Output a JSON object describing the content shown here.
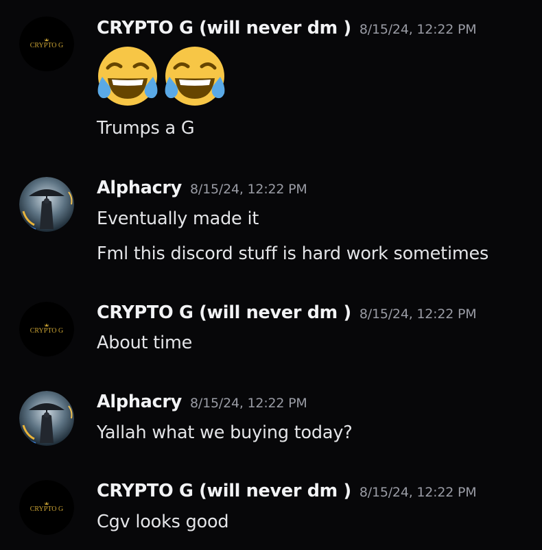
{
  "messages": [
    {
      "author": "CRYPTO G (will never dm )",
      "timestamp": "8/15/24, 12:22 PM",
      "avatar": "crypto-g-logo",
      "avatar_text": "CRYPTO G",
      "emojis": [
        "joy-emoji",
        "joy-emoji"
      ],
      "lines": [
        "Trumps a G"
      ]
    },
    {
      "author": "Alphacry",
      "timestamp": "8/15/24, 12:22 PM",
      "avatar": "umbrella-figure-avatar",
      "lines": [
        "Eventually made it",
        "Fml this discord stuff is hard work sometimes"
      ]
    },
    {
      "author": "CRYPTO G (will never dm )",
      "timestamp": "8/15/24, 12:22 PM",
      "avatar": "crypto-g-logo",
      "avatar_text": "CRYPTO G",
      "lines": [
        "About time"
      ]
    },
    {
      "author": "Alphacry",
      "timestamp": "8/15/24, 12:22 PM",
      "avatar": "umbrella-figure-avatar",
      "lines": [
        "Yallah what we buying today?"
      ]
    },
    {
      "author": "CRYPTO G (will never dm )",
      "timestamp": "8/15/24, 12:22 PM",
      "avatar": "crypto-g-logo",
      "avatar_text": "CRYPTO G",
      "lines": [
        "Cgv looks good"
      ]
    }
  ],
  "colors": {
    "background": "#070709",
    "username": "#f2f3f5",
    "timestamp": "#9a9ca5",
    "message_text": "#e4e5e8",
    "gold": "#c9a233"
  }
}
